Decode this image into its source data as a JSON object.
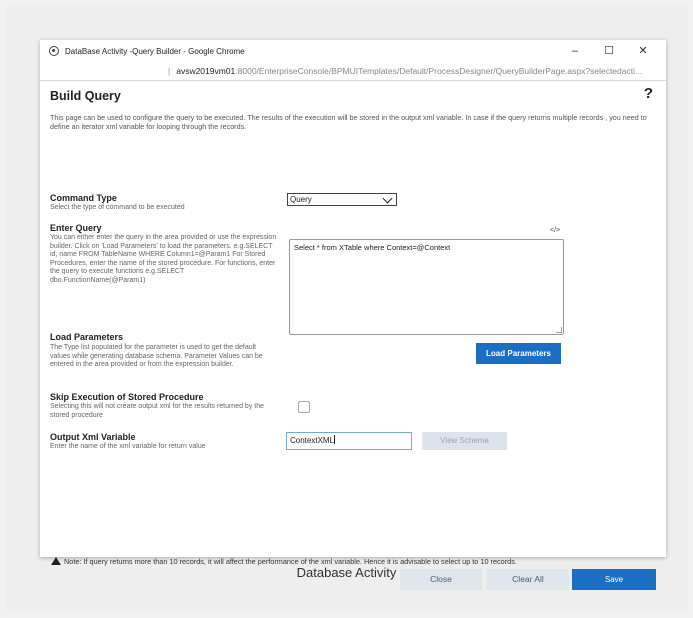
{
  "window": {
    "title": "DataBase Activity -Query Builder - Google Chrome",
    "minimize": "–",
    "maximize": "☐",
    "close": "✕"
  },
  "address": {
    "separator": "|",
    "host": "avsw2019vm01",
    "path": ":8000/EnterpriseConsole/BPMUITemplates/Default/ProcessDesigner/QueryBuilderPage.aspx?selectedacti..."
  },
  "page": {
    "title": "Build Query",
    "help": "?",
    "intro": "This page can be used to configure the query to be executed. The results of the execution will be stored in the output xml variable. In case if the query returns multiple records , you need to define an iterator xml variable for looping through the records."
  },
  "command_type": {
    "label": "Command Type",
    "description": "Select the type of command to be executed",
    "selected": "Query"
  },
  "enter_query": {
    "label": "Enter Query",
    "description": "You can either enter the query in the area provided or use the expression builder. Click on 'Load Parameters' to load the parameters. e.g.SELECT id, name FROM TableName WHERE Column1=@Param1 For Stored Procedures, enter the name of the stored procedure. For functions, enter the query to execute functions e.g.SELECT dbo.FunctionName(@Param1)",
    "expr_icon": "</>",
    "query_text": "Select * from XTable where Context=@Context"
  },
  "load_parameters": {
    "label": "Load Parameters",
    "description": "The Type list populated for the parameter is used to get the default values while generating database schema. Parameter Values can be entered in the area provided or from the expression builder.",
    "button": "Load Parameters"
  },
  "skip_execution": {
    "label": "Skip Execution of Stored Procedure",
    "description": "Selecting this will not create output xml for the results returned by the stored procedure"
  },
  "output_xml": {
    "label": "Output Xml Variable",
    "description": "Enter the name of the xml variable for return value",
    "value": "ContextXML",
    "view_schema": "View Schema"
  },
  "footer": {
    "note": "Note: If query returns more than 10 records, it will affect the performance of the xml variable. Hence it is advisable to select up to 10 records.",
    "close": "Close",
    "clear_all": "Clear All",
    "save": "Save"
  },
  "caption": "Database Activity"
}
